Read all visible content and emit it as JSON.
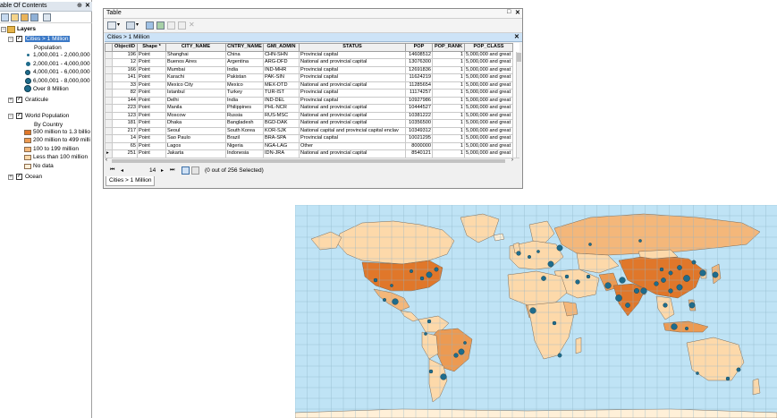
{
  "toc": {
    "title": "able Of Contents",
    "pin_icon": "pin-icon",
    "close_label": "✕",
    "layers_label": "Layers",
    "cities_layer": "Cities > 1 Million",
    "population_label": "Population",
    "population_classes": [
      "1,000,001 - 2,000,000",
      "2,000,001 - 4,000,000",
      "4,000,001 - 6,000,000",
      "6,000,001 - 8,000,000",
      "Over 8 Million"
    ],
    "graticule_layer": "Graticule",
    "world_population_layer": "World Population",
    "by_country_label": "By Country",
    "country_classes": [
      "500 million to 1.3 billio",
      "200 million to 499 milli",
      "100 to 199 million",
      "Less than 100 million",
      "No data"
    ],
    "ocean_layer": "Ocean",
    "colors": {
      "class1": "#e0772a",
      "class2": "#ec9a52",
      "class3": "#f4b77a",
      "class4": "#fdd9aa",
      "class5": "#fff0d8",
      "city": "#1f6c8c"
    }
  },
  "table": {
    "window_title": "Table",
    "tab_label": "Cities > 1 Million",
    "columns": [
      "ObjectID",
      "Shape *",
      "CITY_NAME",
      "CNTRY_NAME",
      "GMI_ADMIN",
      "STATUS",
      "POP",
      "POP_RANK",
      "POP_CLASS"
    ],
    "rows": [
      [
        "196",
        "Point",
        "Shanghai",
        "China",
        "CHN-SHN",
        "Provincial capital",
        "14608512",
        "1",
        "5,000,000 and great"
      ],
      [
        "12",
        "Point",
        "Buenos Aires",
        "Argentina",
        "ARG-DFD",
        "National and provincial capital",
        "13076300",
        "1",
        "5,000,000 and great"
      ],
      [
        "166",
        "Point",
        "Mumbai",
        "India",
        "IND-MHR",
        "Provincial capital",
        "12691836",
        "1",
        "5,000,000 and great"
      ],
      [
        "141",
        "Point",
        "Karachi",
        "Pakistan",
        "PAK-SIN",
        "Provincial capital",
        "11624219",
        "1",
        "5,000,000 and great"
      ],
      [
        "33",
        "Point",
        "Mexico City",
        "Mexico",
        "MEX-DTD",
        "National and provincial capital",
        "11285654",
        "1",
        "5,000,000 and great"
      ],
      [
        "82",
        "Point",
        "Istanbul",
        "Turkey",
        "TUR-IST",
        "Provincial capital",
        "11174257",
        "1",
        "5,000,000 and great"
      ],
      [
        "144",
        "Point",
        "Delhi",
        "India",
        "IND-DEL",
        "Provincial capital",
        "10927986",
        "1",
        "5,000,000 and great"
      ],
      [
        "223",
        "Point",
        "Manila",
        "Philippines",
        "PHL-NCR",
        "National and provincial capital",
        "10444527",
        "1",
        "5,000,000 and great"
      ],
      [
        "123",
        "Point",
        "Moscow",
        "Russia",
        "RUS-MSC",
        "National and provincial capital",
        "10381222",
        "1",
        "5,000,000 and great"
      ],
      [
        "181",
        "Point",
        "Dhaka",
        "Bangladesh",
        "BGD-DAK",
        "National and provincial capital",
        "10356500",
        "1",
        "5,000,000 and great"
      ],
      [
        "217",
        "Point",
        "Seoul",
        "South Korea",
        "KOR-SJK",
        "National capital and provincial capital enclav",
        "10349312",
        "1",
        "5,000,000 and great"
      ],
      [
        "14",
        "Point",
        "Sao Paulo",
        "Brazil",
        "BRA-SPA",
        "Provincial capital",
        "10021295",
        "1",
        "5,000,000 and great"
      ],
      [
        "65",
        "Point",
        "Lagos",
        "Nigeria",
        "NGA-LAG",
        "Other",
        "8000000",
        "1",
        "5,000,000 and great"
      ],
      [
        "251",
        "Point",
        "Jakarta",
        "Indonesia",
        "IDN-JRA",
        "National and provincial capital",
        "8540121",
        "1",
        "5,000,000 and great"
      ]
    ],
    "nav": {
      "current_record": "14",
      "selection_status": "(0 out of 256 Selected)"
    },
    "bottom_tab": "Cities > 1 Million"
  },
  "map": {
    "ocean_color": "#bfe3f5",
    "graticule_color": "#8fb6c9"
  }
}
